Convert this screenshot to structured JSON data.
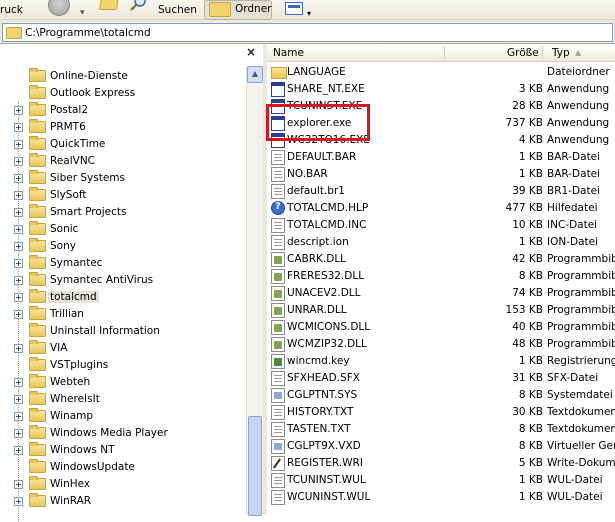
{
  "toolbar": {
    "back_label": "ruck",
    "search_label": "Suchen",
    "folders_label": "Ordner"
  },
  "address": {
    "path": "C:\\Programme\\totalcmd"
  },
  "tree": {
    "close_glyph": "×",
    "items": [
      {
        "label": "Online-Dienste",
        "expandable": false
      },
      {
        "label": "Outlook Express",
        "expandable": false
      },
      {
        "label": "Postal2",
        "expandable": true
      },
      {
        "label": "PRMT6",
        "expandable": true
      },
      {
        "label": "QuickTime",
        "expandable": true
      },
      {
        "label": "RealVNC",
        "expandable": true
      },
      {
        "label": "Siber Systems",
        "expandable": true
      },
      {
        "label": "SlySoft",
        "expandable": true
      },
      {
        "label": "Smart Projects",
        "expandable": true
      },
      {
        "label": "Sonic",
        "expandable": true
      },
      {
        "label": "Sony",
        "expandable": true
      },
      {
        "label": "Symantec",
        "expandable": true
      },
      {
        "label": "Symantec AntiVirus",
        "expandable": true
      },
      {
        "label": "totalcmd",
        "expandable": true,
        "selected": true
      },
      {
        "label": "Trillian",
        "expandable": true
      },
      {
        "label": "Uninstall Information",
        "expandable": false
      },
      {
        "label": "VIA",
        "expandable": true
      },
      {
        "label": "VSTplugins",
        "expandable": false
      },
      {
        "label": "Webteh",
        "expandable": true
      },
      {
        "label": "WhereIsIt",
        "expandable": true
      },
      {
        "label": "Winamp",
        "expandable": true
      },
      {
        "label": "Windows Media Player",
        "expandable": true
      },
      {
        "label": "Windows NT",
        "expandable": true
      },
      {
        "label": "WindowsUpdate",
        "expandable": false
      },
      {
        "label": "WinHex",
        "expandable": true
      },
      {
        "label": "WinRAR",
        "expandable": true
      }
    ]
  },
  "list": {
    "columns": {
      "name": "Name",
      "size": "Größe",
      "type": "Typ"
    },
    "files": [
      {
        "name": "LANGUAGE",
        "size": "",
        "type": "Dateiordner",
        "icon": "folder"
      },
      {
        "name": "SHARE_NT.EXE",
        "size": "3 KB",
        "type": "Anwendung",
        "icon": "exe"
      },
      {
        "name": "TCUNINST.EXE",
        "size": "28 KB",
        "type": "Anwendung",
        "icon": "exe"
      },
      {
        "name": "explorer.exe",
        "size": "737 KB",
        "type": "Anwendung",
        "icon": "exe"
      },
      {
        "name": "WC32TO16.EXE",
        "size": "4 KB",
        "type": "Anwendung",
        "icon": "exe"
      },
      {
        "name": "DEFAULT.BAR",
        "size": "1 KB",
        "type": "BAR-Datei",
        "icon": "doc"
      },
      {
        "name": "NO.BAR",
        "size": "1 KB",
        "type": "BAR-Datei",
        "icon": "doc"
      },
      {
        "name": "default.br1",
        "size": "39 KB",
        "type": "BR1-Datei",
        "icon": "doc"
      },
      {
        "name": "TOTALCMD.HLP",
        "size": "477 KB",
        "type": "Hilfedatei",
        "icon": "help"
      },
      {
        "name": "TOTALCMD.INC",
        "size": "10 KB",
        "type": "INC-Datei",
        "icon": "doc"
      },
      {
        "name": "descript.ion",
        "size": "1 KB",
        "type": "ION-Datei",
        "icon": "doc"
      },
      {
        "name": "CABRK.DLL",
        "size": "42 KB",
        "type": "Programmbiblio",
        "icon": "dll"
      },
      {
        "name": "FRERES32.DLL",
        "size": "8 KB",
        "type": "Programmbiblio",
        "icon": "dll"
      },
      {
        "name": "UNACEV2.DLL",
        "size": "74 KB",
        "type": "Programmbiblio",
        "icon": "dll"
      },
      {
        "name": "UNRAR.DLL",
        "size": "153 KB",
        "type": "Programmbiblio",
        "icon": "dll"
      },
      {
        "name": "WCMICONS.DLL",
        "size": "40 KB",
        "type": "Programmbiblio",
        "icon": "dll"
      },
      {
        "name": "WCMZIP32.DLL",
        "size": "48 KB",
        "type": "Programmbiblio",
        "icon": "dll"
      },
      {
        "name": "wincmd.key",
        "size": "1 KB",
        "type": "Registrierungs",
        "icon": "reg"
      },
      {
        "name": "SFXHEAD.SFX",
        "size": "31 KB",
        "type": "SFX-Datei",
        "icon": "doc"
      },
      {
        "name": "CGLPTNT.SYS",
        "size": "8 KB",
        "type": "Systemdatei",
        "icon": "sys"
      },
      {
        "name": "HISTORY.TXT",
        "size": "30 KB",
        "type": "Textdokument",
        "icon": "doc"
      },
      {
        "name": "TASTEN.TXT",
        "size": "8 KB",
        "type": "Textdokument",
        "icon": "doc"
      },
      {
        "name": "CGLPT9X.VXD",
        "size": "8 KB",
        "type": "Virtueller Gerä",
        "icon": "sys"
      },
      {
        "name": "REGISTER.WRI",
        "size": "5 KB",
        "type": "Write-Dokume",
        "icon": "wri"
      },
      {
        "name": "TCUNINST.WUL",
        "size": "1 KB",
        "type": "WUL-Datei",
        "icon": "doc"
      },
      {
        "name": "WCUNINST.WUL",
        "size": "1 KB",
        "type": "WUL-Datei",
        "icon": "doc"
      }
    ]
  },
  "colors": {
    "highlight": "#d9161c",
    "folder": "#eac659",
    "selection": "#e4e2db"
  }
}
